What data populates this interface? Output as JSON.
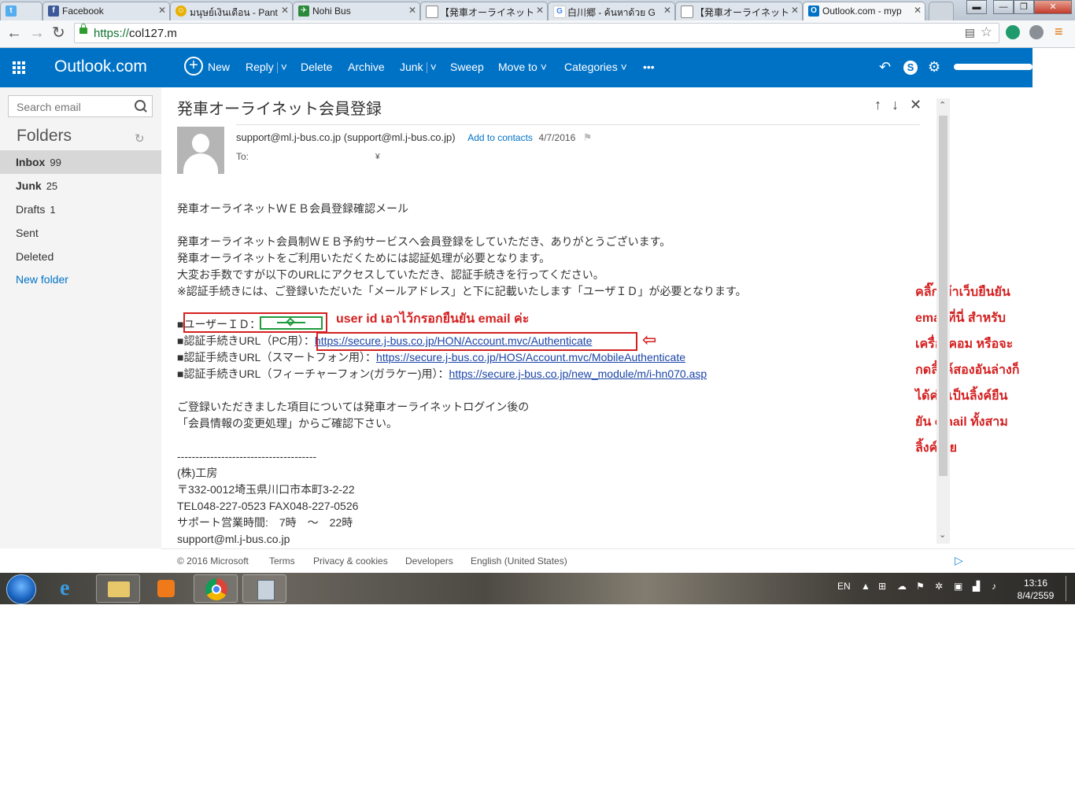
{
  "browser": {
    "tabs": [
      {
        "title": "",
        "icon": "twitter-icon",
        "color": "#55acee"
      },
      {
        "title": "Facebook",
        "icon": "facebook-icon",
        "color": "#3b5998"
      },
      {
        "title": "มนุษย์เงินเดือน - Pantip",
        "icon": "pantip-icon",
        "color": "#e8b000"
      },
      {
        "title": "Nohi Bus",
        "icon": "nohi-icon",
        "color": "#2a8a3a"
      },
      {
        "title": "【発車オーライネット",
        "icon": "page-icon",
        "color": "#ffffff"
      },
      {
        "title": "白川郷 - ค้นหาด้วย G",
        "icon": "google-icon",
        "color": "#4285f4"
      },
      {
        "title": "【発車オーライネット",
        "icon": "page-icon",
        "color": "#ffffff"
      },
      {
        "title": "Outlook.com - myp",
        "icon": "outlook-icon",
        "color": "#0072c6"
      }
    ],
    "url_scheme": "https://",
    "url_rest": "col127.m"
  },
  "outlook": {
    "brand": "Outlook.com",
    "commands": {
      "new": "New",
      "reply": "Reply",
      "delete": "Delete",
      "archive": "Archive",
      "junk": "Junk",
      "sweep": "Sweep",
      "move_to": "Move to",
      "categories": "Categories",
      "more": "•••"
    },
    "accent": "#0072c6"
  },
  "sidebar": {
    "search_placeholder": "Search email",
    "folders_title": "Folders",
    "items": [
      {
        "label": "Inbox",
        "count": "99"
      },
      {
        "label": "Junk",
        "count": "25"
      },
      {
        "label": "Drafts",
        "count": "1"
      },
      {
        "label": "Sent",
        "count": ""
      },
      {
        "label": "Deleted",
        "count": ""
      },
      {
        "label": "New folder",
        "count": ""
      }
    ]
  },
  "message": {
    "subject": "発車オーライネット会員登録",
    "sender": "support@ml.j-bus.co.jp",
    "sender_paren": "(support@ml.j-bus.co.jp)",
    "add_contacts": "Add to contacts",
    "date": "4/7/2016",
    "to_label": "To:",
    "body": {
      "l1": "発車オーライネットＷＥＢ会員登録確認メール",
      "l2": "発車オーライネット会員制ＷＥＢ予約サービスへ会員登録をしていただき、ありがとうございます。",
      "l3": "発車オーライネットをご利用いただくためには認証処理が必要となります。",
      "l4": "大変お手数ですが以下のURLにアクセスしていただき、認証手続きを行ってください。",
      "l5": "※認証手続きには、ご登録いただいた「メールアドレス」と下に記載いたします「ユーザＩＤ」が必要となります。",
      "uid_label": "■ユーザーＩＤ：",
      "pc_label": "■認証手続きURL（PC用）：",
      "pc_url": "https://secure.j-bus.co.jp/HON/Account.mvc/Authenticate",
      "sp_label": "■認証手続きURL（スマートフォン用）：",
      "sp_url": "https://secure.j-bus.co.jp/HOS/Account.mvc/MobileAuthenticate",
      "fp_label": "■認証手続きURL（フィーチャーフォン(ガラケー)用）：",
      "fp_url": "https://secure.j-bus.co.jp/new_module/m/i-hn070.asp",
      "l6": "ご登録いただきました項目については発車オーライネットログイン後の",
      "l7": "「会員情報の変更処理」からご確認下さい。",
      "dashes": "--------------------------------------",
      "sig1": "(株)工房",
      "sig2": "〒332-0012埼玉県川口市本町3-2-22",
      "sig3": "TEL048-227-0523 FAX048-227-0526",
      "sig4": "サポート営業時間:　7時　～　22時",
      "sig5": "support@ml.j-bus.co.jp"
    }
  },
  "annotations": {
    "uid_note": "user id เอาไว้กรอกยืนยัน email ค่ะ",
    "side_lines": [
      "คลิ๊กเข้าเว็บยืนยัน",
      "emailที่นี่ สำหรับ",
      "เครื่องคอม หรือจะ",
      "กดลิ้งค์สองอันล่างก็",
      "ได้ค่ะ เป็นลิ้งค์ยืน",
      "ยัน email ทั้งสาม",
      "ลิ้งค์เลย"
    ],
    "red": "#d42020",
    "green": "#1f9a3c"
  },
  "footer": {
    "copyright": "© 2016 Microsoft",
    "terms": "Terms",
    "privacy": "Privacy & cookies",
    "developers": "Developers",
    "language": "English (United States)"
  },
  "taskbar": {
    "lang": "EN",
    "time": "13:16",
    "date": "8/4/2559"
  }
}
